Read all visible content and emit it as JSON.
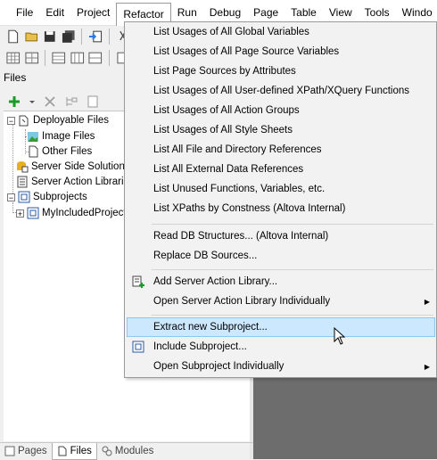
{
  "menubar": {
    "items": [
      "File",
      "Edit",
      "Project",
      "Refactor",
      "Run",
      "Debug",
      "Page",
      "Table",
      "View",
      "Tools",
      "Windo"
    ],
    "active": "Refactor"
  },
  "files_pane": {
    "title": "Files",
    "tree": [
      {
        "label": "Deployable Files",
        "icon": "folder-icon"
      },
      {
        "label": "Image Files",
        "icon": "image-folder-icon"
      },
      {
        "label": "Other Files",
        "icon": "file-icon"
      },
      {
        "label": "Server Side Solution",
        "icon": "server-solution-icon"
      },
      {
        "label": "Server Action Librari",
        "icon": "library-icon"
      },
      {
        "label": "Subprojects",
        "icon": "subproject-icon"
      },
      {
        "label": "MyIncludedProject",
        "icon": "subproject-icon"
      }
    ]
  },
  "bottom_tabs": [
    {
      "label": "Pages",
      "icon": "pages-icon"
    },
    {
      "label": "Files",
      "icon": "files-icon"
    },
    {
      "label": "Modules",
      "icon": "modules-icon"
    }
  ],
  "refactor_menu": {
    "group1": [
      "List Usages of All Global Variables",
      "List Usages of All Page Source Variables",
      "List Page Sources by Attributes",
      "List Usages of All User-defined XPath/XQuery Functions",
      "List Usages of All Action Groups",
      "List Usages of All Style Sheets",
      "List All File and Directory References",
      "List All External Data References",
      "List Unused Functions, Variables, etc.",
      "List XPaths by Constness (Altova Internal)"
    ],
    "group2": [
      "Read DB Structures... (Altova Internal)",
      "Replace DB Sources..."
    ],
    "group3": [
      "Add Server Action Library...",
      "Open Server Action Library Individually"
    ],
    "group4": [
      "Extract new Subproject...",
      "Include Subproject...",
      "Open Subproject Individually"
    ],
    "hover_color": "#cce8ff"
  }
}
